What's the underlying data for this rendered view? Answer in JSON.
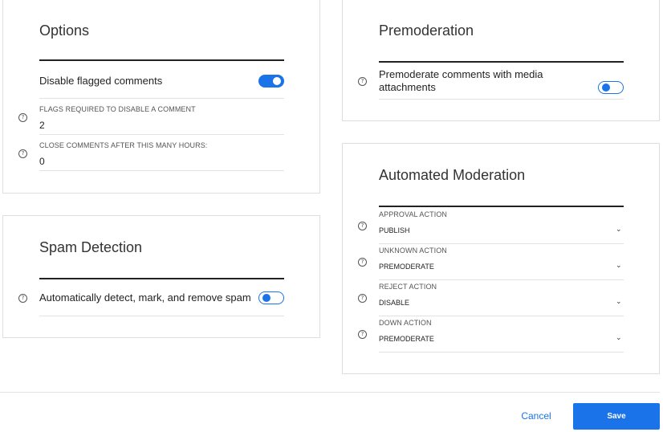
{
  "options": {
    "title": "Options",
    "disable_flagged_label": "Disable flagged comments",
    "disable_flagged_on": true,
    "flags_required_caption": "FLAGS REQUIRED TO DISABLE A COMMENT",
    "flags_required_value": "2",
    "close_hours_caption": "CLOSE COMMENTS AFTER THIS MANY HOURS:",
    "close_hours_value": "0"
  },
  "spam": {
    "title": "Spam Detection",
    "auto_detect_label": "Automatically detect, mark, and remove spam",
    "auto_detect_on": false
  },
  "premoderation": {
    "title": "Premoderation",
    "media_label": "Premoderate comments with media attachments",
    "media_on": false
  },
  "automated": {
    "title": "Automated Moderation",
    "actions": [
      {
        "caption": "APPROVAL ACTION",
        "value": "PUBLISH"
      },
      {
        "caption": "UNKNOWN ACTION",
        "value": "PREMODERATE"
      },
      {
        "caption": "REJECT ACTION",
        "value": "DISABLE"
      },
      {
        "caption": "DOWN ACTION",
        "value": "PREMODERATE"
      }
    ]
  },
  "footer": {
    "cancel_label": "Cancel",
    "save_label": "Save"
  },
  "icons": {
    "help": "help-circle-icon",
    "toggle": "toggle-switch",
    "select": "chevron-down-icon"
  },
  "colors": {
    "accent": "#1a73e8",
    "rule": "#222222",
    "border": "#dedede"
  }
}
